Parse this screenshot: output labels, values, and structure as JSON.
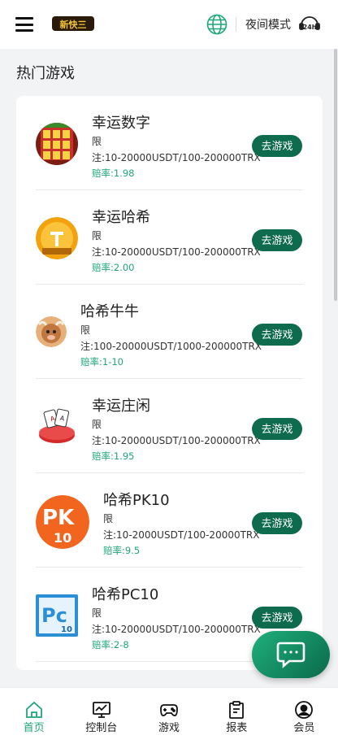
{
  "header": {
    "logo_text": "新快三",
    "night_mode_label": "夜间模式",
    "support_badge": "24h"
  },
  "section_title": "热门游戏",
  "play_label": "去游戏",
  "games": [
    {
      "name": "幸运数字",
      "limit": "限\n注:10-20000USDT/100-200000TRX",
      "limit_a": "限",
      "limit_b": "注:10-20000USDT/100-200000TRX",
      "odds": "赔率:1.98",
      "icon": "lucky-number-icon"
    },
    {
      "name": "幸运哈希",
      "limit_a": "限",
      "limit_b": "注:10-20000USDT/100-200000TRX",
      "odds": "赔率:2.00",
      "icon": "lucky-hash-icon"
    },
    {
      "name": "哈希牛牛",
      "limit_a": "限",
      "limit_b": "注:100-20000USDT/1000-200000TRX",
      "odds": "赔率:1-10",
      "icon": "hash-niuniu-icon"
    },
    {
      "name": "幸运庄闲",
      "limit_a": "限",
      "limit_b": "注:10-20000USDT/100-200000TRX",
      "odds": "赔率:1.95",
      "icon": "lucky-baccarat-icon"
    },
    {
      "name": "哈希PK10",
      "limit_a": "限",
      "limit_b": "注:10-2000USDT/100-20000TRX",
      "odds": "赔率:9.5",
      "icon": "hash-pk10-icon"
    },
    {
      "name": "哈希PC10",
      "limit_a": "限",
      "limit_b": "注:10-20000USDT/100-200000TRX",
      "odds": "赔率:2-8",
      "icon": "hash-pc10-icon"
    }
  ],
  "tabs": [
    {
      "label": "首页",
      "icon": "home-icon",
      "active": true
    },
    {
      "label": "控制台",
      "icon": "console-icon",
      "active": false
    },
    {
      "label": "游戏",
      "icon": "gamepad-icon",
      "active": false
    },
    {
      "label": "报表",
      "icon": "report-icon",
      "active": false
    },
    {
      "label": "会员",
      "icon": "member-icon",
      "active": false
    }
  ],
  "colors": {
    "accent": "#1ea77a",
    "button": "#0f6b4e"
  }
}
